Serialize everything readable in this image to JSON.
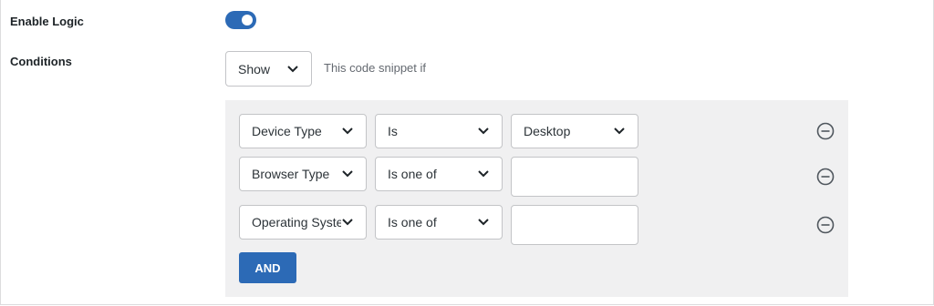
{
  "settings": {
    "enable_logic_label": "Enable Logic",
    "enable_logic_on": true,
    "conditions_label": "Conditions"
  },
  "visibility": {
    "selected": "Show",
    "hint": "This code snippet if"
  },
  "rules": [
    {
      "field": "Device Type",
      "operator": "Is",
      "value": "Desktop",
      "value_type": "select"
    },
    {
      "field": "Browser Type",
      "operator": "Is one of",
      "value": "",
      "value_type": "text"
    },
    {
      "field": "Operating Syste",
      "operator": "Is one of",
      "value": "",
      "value_type": "text"
    }
  ],
  "and_button_label": "AND",
  "colors": {
    "accent": "#2c6ab6",
    "panel_bg": "#f0f0f1",
    "border": "#c3c4c7"
  },
  "icons": {
    "dropdown": "chevron-down-icon",
    "remove": "minus-circle-icon"
  }
}
